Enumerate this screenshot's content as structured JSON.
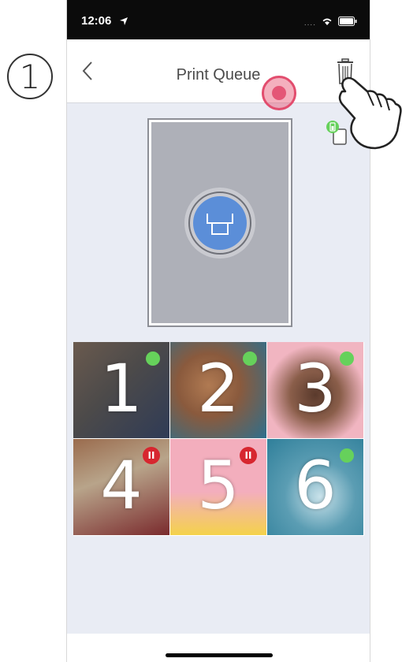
{
  "step": {
    "number": "1"
  },
  "status_bar": {
    "time": "12:06",
    "signal": "....",
    "location_icon": "location-arrow-icon",
    "wifi_icon": "wifi-icon",
    "battery_icon": "battery-icon"
  },
  "nav": {
    "title": "Print Queue",
    "back_icon": "chevron-left-icon",
    "trash_icon": "trash-icon"
  },
  "preview": {
    "print_icon": "printer-icon",
    "printer_status_icon": "printer-battery-icon"
  },
  "colors": {
    "accent": "#5b8ed8",
    "ok": "#66d15b",
    "paused": "#d7262f",
    "tap_highlight": "#e24d6e"
  },
  "queue": [
    {
      "number": "1",
      "status": "ready",
      "colors": [
        "#6a5a4e",
        "#2f3b56"
      ]
    },
    {
      "number": "2",
      "status": "ready",
      "colors": [
        "#b07a52",
        "#2d6f8d"
      ]
    },
    {
      "number": "3",
      "status": "ready",
      "colors": [
        "#f1b5c1",
        "#5a3a2c"
      ]
    },
    {
      "number": "4",
      "status": "paused",
      "colors": [
        "#9a6b4d",
        "#7a2a2d"
      ]
    },
    {
      "number": "5",
      "status": "paused",
      "colors": [
        "#f3aebd",
        "#f4d24b"
      ]
    },
    {
      "number": "6",
      "status": "ready",
      "colors": [
        "#2f7f9a",
        "#c9e2ea"
      ]
    }
  ],
  "pause_glyph": "II"
}
